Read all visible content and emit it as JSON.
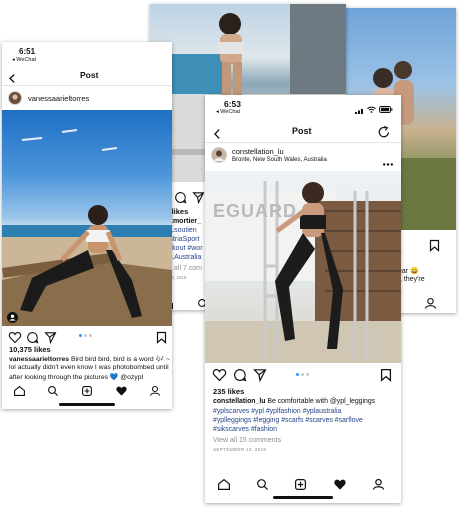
{
  "left_phone": {
    "status_time": "6:51",
    "back_app": "◂ WeChat",
    "nav_title": "Post",
    "username": "vanessaarieltorres",
    "likes": "10,375 likes",
    "caption_user": "vanessaarieltorres",
    "caption_text": "Bird bird bird, bird is a word 🎶 ~",
    "caption_line2": "lol actually didn't even know I was photobombed until",
    "caption_line3": "after looking through the pictures 💙 @ozypl"
  },
  "back_middle": {
    "likes": "485 likes",
    "caption_user": "beckmortier_",
    "caption_lines": [
      "#YPLsoutien",
      "#AustriaSport",
      "#workout #wor",
      "#YPLAustralia"
    ],
    "view_comments": "View all 7 com",
    "date": "JULY 22, 2018"
  },
  "back_right": {
    "comment_fragment_1": "ear 😄",
    "comment_fragment_2": "t, they're"
  },
  "front_phone": {
    "status_time": "6:53",
    "back_app": "◂ WeChat",
    "nav_title": "Post",
    "username": "constellation_lu",
    "location": "Bronte, New South Wales, Australia",
    "photo_sign_text": "EGUARD",
    "likes": "235 likes",
    "caption_user": "constellation_lu",
    "caption_text": "Be comfortable with @ypl_leggings",
    "caption_line2": "#yplscarves #ypl #yplfashion #yplaustralia",
    "caption_line3": "#yplleggings #legging #scarfs #scarves #sarflove",
    "caption_line4": "#sikscarves #fashion",
    "view_comments": "View all 15 comments",
    "date": "SEPTEMBER 13, 2018"
  },
  "colors": {
    "link_tag": "#27458a",
    "dot_active": "#3897f0",
    "muted": "#8e8e8e"
  }
}
